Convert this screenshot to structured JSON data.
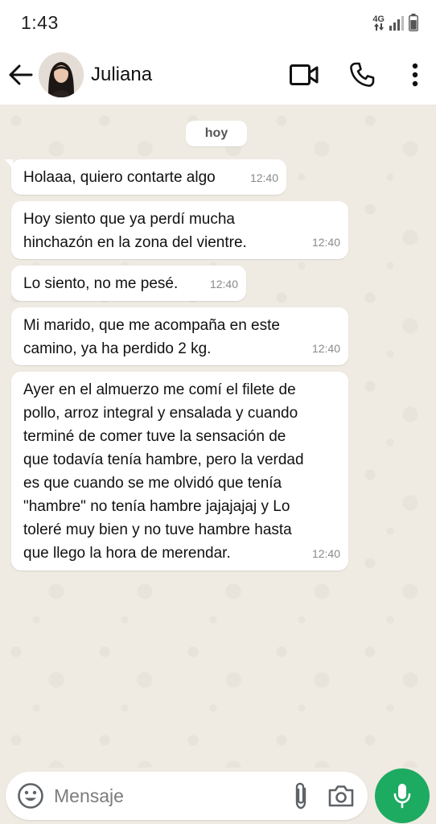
{
  "status_bar": {
    "time": "1:43",
    "network": "4G"
  },
  "header": {
    "contact_name": "Juliana",
    "back_icon": "arrow-left-icon",
    "video_icon": "videocam-icon",
    "call_icon": "phone-icon",
    "menu_icon": "more-vert-icon"
  },
  "chat": {
    "date_label": "hoy",
    "messages": [
      {
        "text": "Holaaa, quiero contarte algo",
        "time": "12:40"
      },
      {
        "text": "Hoy siento que ya perdí mucha\nhinchazón en la zona del vientre.",
        "time": "12:40"
      },
      {
        "text": "Lo siento, no me pesé.",
        "time": "12:40"
      },
      {
        "text": "Mi marido, que me acompaña en este\ncamino, ya ha perdido 2 kg.",
        "time": "12:40"
      },
      {
        "text": "Ayer en el almuerzo me comí el filete de\npollo, arroz integral y ensalada y cuando\nterminé de comer tuve la sensación de\nque todavía tenía hambre, pero la verdad\nes que cuando se me olvidó que tenía\n\"hambre\" no tenía hambre jajajajaj y Lo\ntoleré muy bien y no tuve hambre hasta\nque llego la hora de merendar.",
        "time": "12:40"
      }
    ]
  },
  "composer": {
    "placeholder": "Mensaje",
    "value": ""
  },
  "colors": {
    "accent": "#1daa61",
    "chat_bg": "#efeae2",
    "bubble_in": "#ffffff"
  }
}
